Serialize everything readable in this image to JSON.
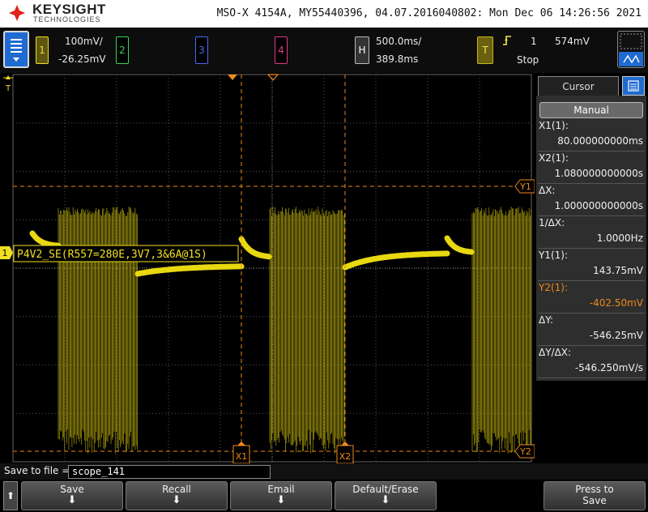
{
  "header": {
    "brand": "KEYSIGHT",
    "brand_sub": "TECHNOLOGIES",
    "device_info": "MSO-X 4154A, MY55440396, 04.07.2016040802: Mon Dec 06 14:26:56 2021"
  },
  "channels": [
    {
      "num": "1",
      "scale": "100mV/",
      "offset": "-26.25mV",
      "color": "#f0e020",
      "active": true
    },
    {
      "num": "2",
      "color": "#39d353",
      "active": false
    },
    {
      "num": "3",
      "color": "#4a6cf0",
      "active": false
    },
    {
      "num": "4",
      "color": "#e23a8a",
      "active": false
    }
  ],
  "horizontal": {
    "label": "H",
    "scale": "500.0ms/",
    "delay": "389.8ms"
  },
  "trigger": {
    "label": "T",
    "icon": "rising-edge-icon",
    "source": "1",
    "level": "574mV",
    "state": "Stop"
  },
  "waveform": {
    "label_text": "P4V2_SE(R557=280E,3V7,3&6A@1S)",
    "channel_marker": "1",
    "color": "#e8d810",
    "cursor_color": "#f08a1a",
    "markers": {
      "x1": "X1",
      "x2": "X2",
      "y1": "Y1",
      "y2": "Y2"
    }
  },
  "cursor_panel": {
    "title": "Cursor",
    "mode": "Manual",
    "rows": [
      {
        "label": "X1(1):",
        "value": "80.000000000ms"
      },
      {
        "label": "X2(1):",
        "value": "1.080000000000s"
      },
      {
        "label": "ΔX:",
        "value": "1.000000000000s"
      },
      {
        "label": "1/ΔX:",
        "value": "1.0000Hz"
      },
      {
        "label": "Y1(1):",
        "value": "143.75mV"
      },
      {
        "label": "Y2(1):",
        "value": "-402.50mV",
        "color": "#f08a1a"
      },
      {
        "label": "ΔY:",
        "value": "-546.25mV"
      },
      {
        "label": "ΔY/ΔX:",
        "value": "-546.250mV/s"
      }
    ]
  },
  "file": {
    "label": "Save to file =",
    "value": "scope_141"
  },
  "softkeys": [
    {
      "label": "Save"
    },
    {
      "label": "Recall"
    },
    {
      "label": "Email"
    },
    {
      "label": "Default/Erase"
    },
    {
      "label": "Press to",
      "label2": "Save"
    }
  ]
}
